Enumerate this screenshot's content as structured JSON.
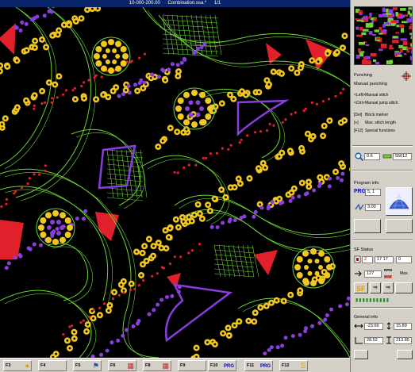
{
  "window": {
    "title": "10-000-200.00",
    "document": "Combination.ssa.*",
    "page": "1/1"
  },
  "colors": {
    "background": "#000000",
    "outline": "#6ed436",
    "sequin_gold": "#f2c81c",
    "sequin_purple": "#8a3ee0",
    "dots_red": "#e0202a",
    "panel": "#d4d0c8",
    "highlight": "#0000cc"
  },
  "panel": {
    "punching": {
      "title": "Punching",
      "mode": "Manual punching",
      "shortcuts": [
        {
          "key": "<Left>",
          "text": "Manual stitch"
        },
        {
          "key": "<Ctrl>",
          "text": "Manual jump stitch"
        },
        {
          "key": "[Del]",
          "text": "Block marker"
        },
        {
          "key": "[+]",
          "text": "Max. stitch length"
        },
        {
          "key": "[F12]",
          "text": "Special functions"
        }
      ]
    },
    "zoom": {
      "value": "0.6",
      "count": "55612",
      "icon": "magnifier-icon"
    },
    "program": {
      "title": "Program info",
      "prg_label": "PRG",
      "prg_value": "5, 1",
      "width_value": "3.00"
    },
    "sf_status": {
      "title": "SF Status",
      "first": "2",
      "second": "17 17",
      "third": "0",
      "speed": "127",
      "rpm_label": "RPM",
      "mode": "Max."
    },
    "general": {
      "title": "General info",
      "h1": "-23.69",
      "h2": "15.89",
      "v1": "28.52",
      "v2": "213.85"
    }
  },
  "function_keys": [
    {
      "label": "F3",
      "icon": "sequin-palette-icon"
    },
    {
      "label": "F4",
      "icon": ""
    },
    {
      "label": "F5",
      "icon": "flag-icon"
    },
    {
      "label": "F6",
      "icon": "grid-icon"
    },
    {
      "label": "F8",
      "icon": "grid-icon"
    },
    {
      "label": "F9",
      "icon": ""
    },
    {
      "label": "F10",
      "icon": "prg-arrow-icon",
      "text": "PRG"
    },
    {
      "label": "F11",
      "icon": "prg-icon",
      "text": "PRG"
    },
    {
      "label": "F12",
      "icon": "sf-icon"
    }
  ]
}
